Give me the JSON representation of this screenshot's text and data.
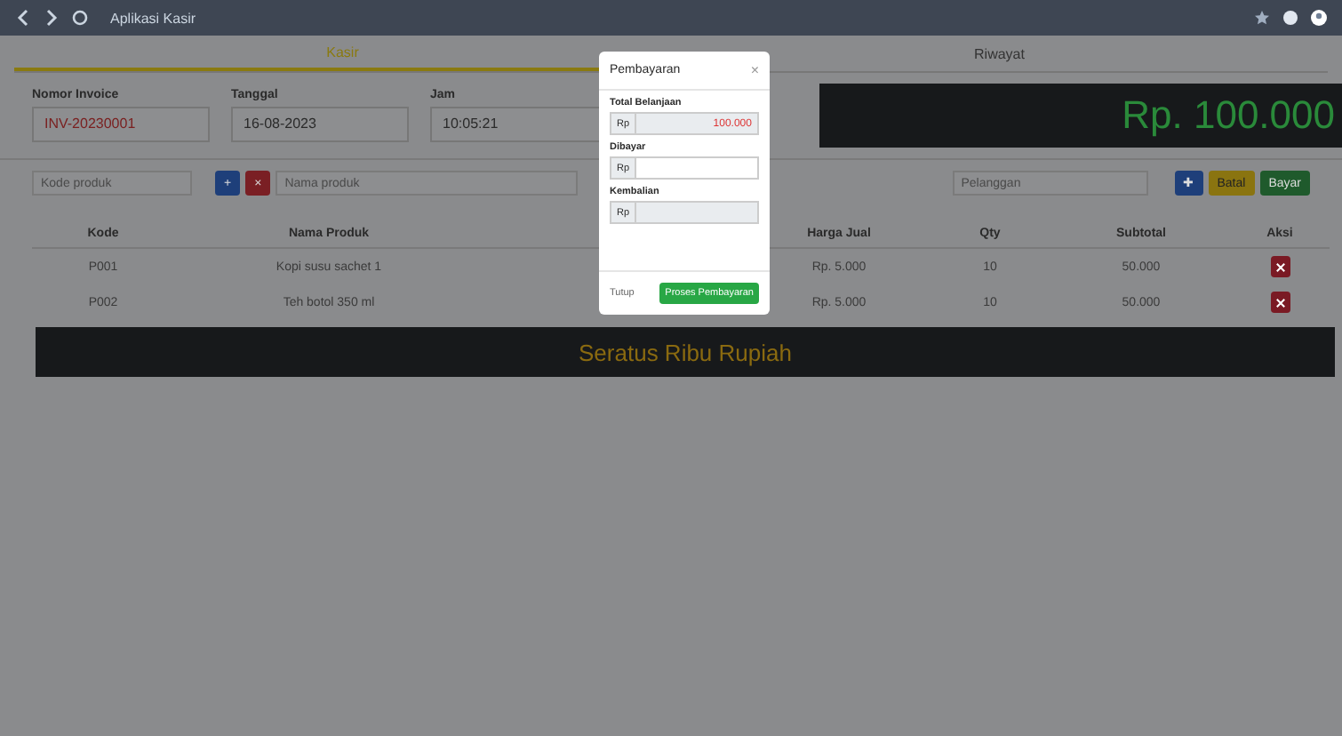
{
  "topbar": {
    "title": "Aplikasi Kasir"
  },
  "tabs": [
    {
      "label": "Kasir",
      "selected": true
    },
    {
      "label": "Riwayat",
      "selected": false
    }
  ],
  "info": {
    "fields": [
      {
        "label": "Nomor Invoice",
        "value": "INV-20230001",
        "kind": "highlight"
      },
      {
        "label": "Tanggal",
        "value": "16-08-2023",
        "kind": "plain"
      },
      {
        "label": "Jam",
        "value": "10:05:21",
        "kind": "plain"
      }
    ],
    "total_display": "Rp. 100.000"
  },
  "search": {
    "placeholder": "Kode produk",
    "product_placeholder": "Nama produk",
    "customer_placeholder": "Pelanggan"
  },
  "left_buttons": [
    {
      "label": "+",
      "kind": "primary"
    },
    {
      "label": "×",
      "kind": "danger"
    }
  ],
  "right_buttons": [
    {
      "label": "✚",
      "kind": "primary"
    },
    {
      "label": "Batal",
      "kind": "warning"
    },
    {
      "label": "Bayar",
      "kind": "success"
    }
  ],
  "table": {
    "columns": [
      "Kode",
      "Nama Produk",
      "Harga Jual",
      "Qty",
      "Subtotal",
      "Aksi"
    ],
    "rows": [
      [
        "P001",
        "Kopi susu sachet 1",
        "Rp. 5.000",
        "10",
        "50.000"
      ],
      [
        "P002",
        "Teh botol 350 ml",
        "Rp. 5.000",
        "10",
        "50.000"
      ]
    ]
  },
  "terbilang": "Seratus Ribu Rupiah",
  "modal": {
    "title": "Pembayaran",
    "close": "×",
    "fields": [
      {
        "label": "Total Belanjaan",
        "prefix": "Rp",
        "value": "100.000",
        "kind": "readonly"
      },
      {
        "label": "Dibayar",
        "prefix": "Rp",
        "kind": "input"
      },
      {
        "label": "Kembalian",
        "prefix": "Rp",
        "kind": "readonly"
      }
    ],
    "cancel": "Tutup",
    "submit": "Proses Pembayaran"
  }
}
